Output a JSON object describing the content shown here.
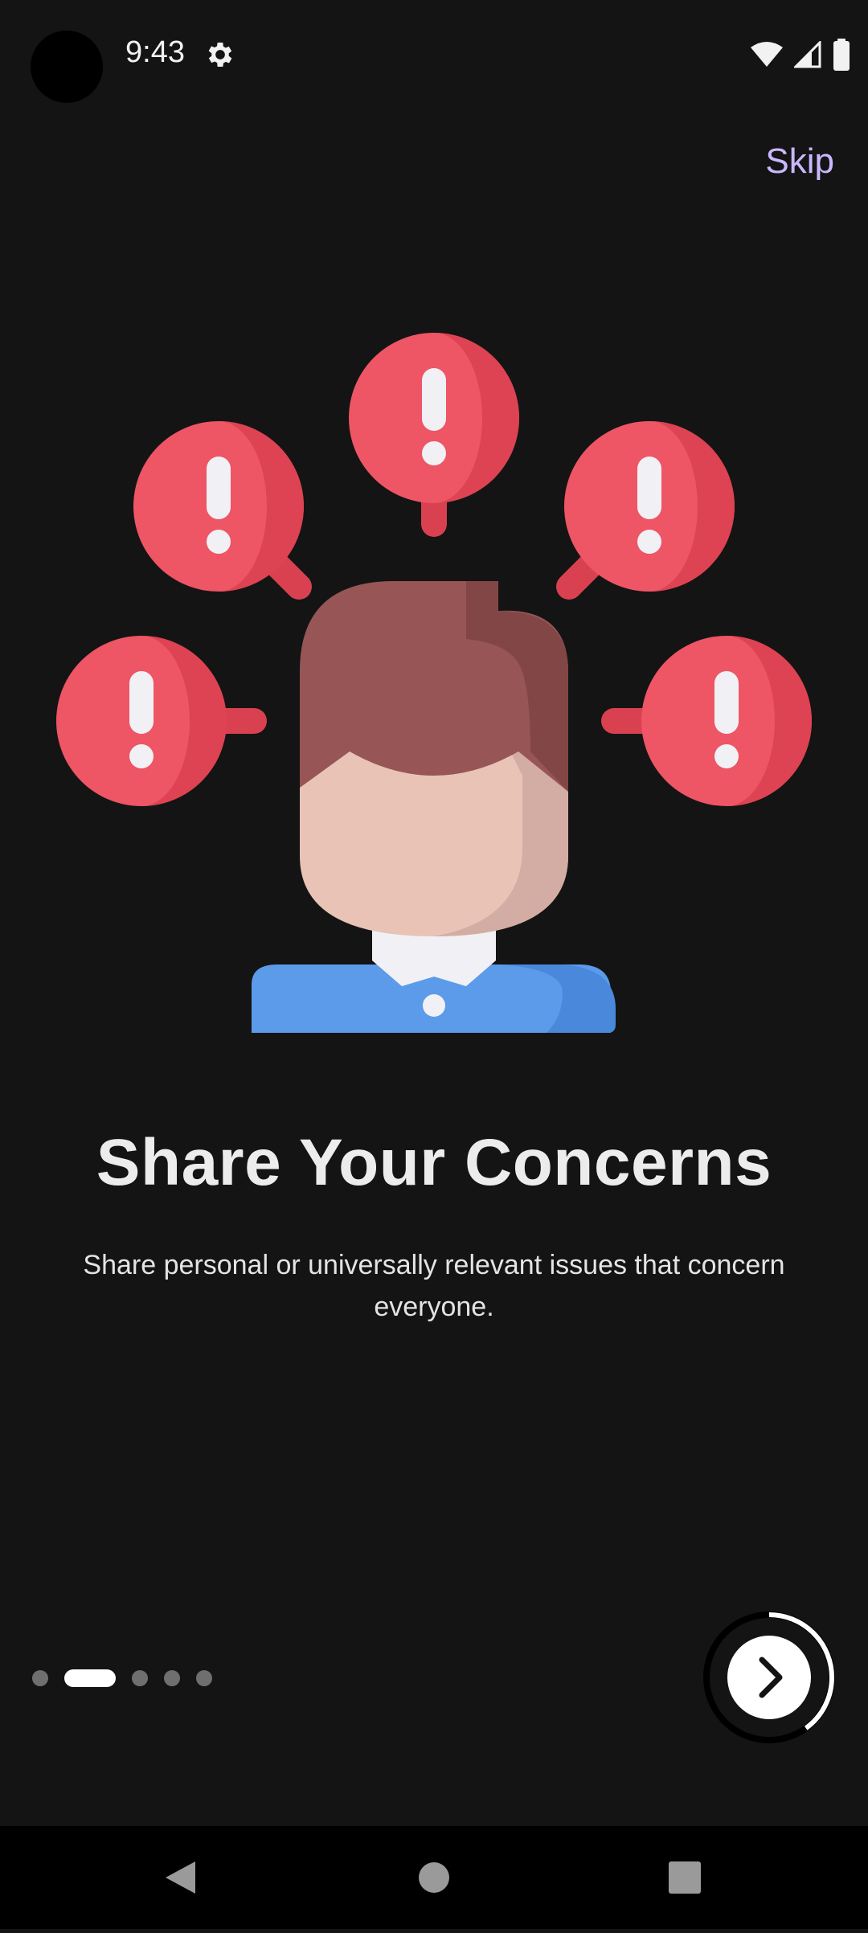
{
  "status_bar": {
    "time": "9:43",
    "icons": [
      "settings-gear-icon",
      "wifi-icon",
      "cellular-signal-icon",
      "battery-icon"
    ]
  },
  "onboarding": {
    "skip_label": "Skip",
    "title": "Share Your Concerns",
    "description": "Share personal or universally relevant issues that concern everyone.",
    "page_indicator": {
      "count": 5,
      "current": 2
    },
    "progress": 0.4,
    "next_icon": "chevron-right-icon"
  },
  "nav_bar": {
    "icons": [
      "back-triangle-icon",
      "home-circle-icon",
      "recents-square-icon"
    ]
  },
  "colors": {
    "background": "#141414",
    "accent": "#cbb7ff",
    "bubble_red": "#ee5565",
    "shirt_blue": "#5b9be9",
    "hair_brown": "#975555"
  }
}
